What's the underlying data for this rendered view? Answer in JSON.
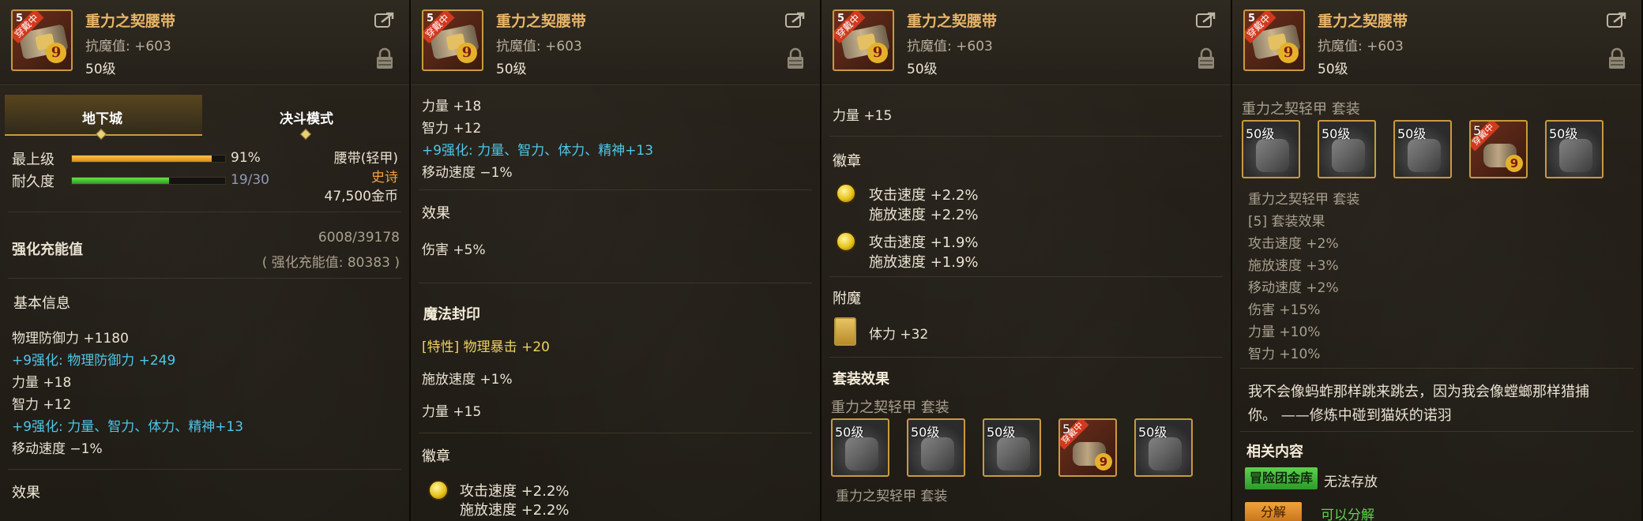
{
  "header": {
    "title": "重力之契腰带",
    "stat": "抗魔值: +603",
    "level": "50级",
    "icon_badge": "穿戴中",
    "icon_number": "9",
    "icon_corner": "5"
  },
  "panel1": {
    "tabs": [
      "地下城",
      "决斗模式"
    ],
    "active_tab": 0,
    "max_level_label": "最上级",
    "max_level_value": "91%",
    "max_level_fraction": 0.91,
    "durability_label": "耐久度",
    "durability_value": "19/30",
    "durability_fraction": 0.633,
    "slot_type": "腰带(轻甲)",
    "rarity": "史诗",
    "price": "47,500金币",
    "amplify_label": "强化充能值",
    "amplify_value": "6008/39178",
    "amplify_note": "( 强化充能值: 80383 )",
    "basic_info": "基本信息",
    "lines": [
      {
        "text": "物理防御力 +1180",
        "color": "white"
      },
      {
        "text": "+9强化: 物理防御力 +249",
        "color": "cyan"
      },
      {
        "text": "力量 +18",
        "color": "white"
      },
      {
        "text": "智力 +12",
        "color": "white"
      },
      {
        "text": "+9强化: 力量、智力、体力、精神+13",
        "color": "cyan"
      },
      {
        "text": "移动速度 −1%",
        "color": "white"
      }
    ],
    "effects_label": "效果"
  },
  "panel2": {
    "lines_top": [
      {
        "text": "力量 +18",
        "color": "white"
      },
      {
        "text": "智力 +12",
        "color": "white"
      },
      {
        "text": "+9强化: 力量、智力、体力、精神+13",
        "color": "cyan"
      },
      {
        "text": "移动速度 −1%",
        "color": "white"
      }
    ],
    "effects_label": "效果",
    "damage": "伤害 +5%",
    "magic_seal_label": "魔法封印",
    "trait": "[特性] 物理暴击 +20",
    "cast_speed": "施放速度 +1%",
    "strength": "力量 +15",
    "emblem_label": "徽章",
    "emblem_line1": "攻击速度 +2.2%",
    "emblem_line2": "施放速度 +2.2%"
  },
  "panel3": {
    "strength": "力量 +15",
    "emblem_label": "徽章",
    "emblems": [
      {
        "line1": "攻击速度 +2.2%",
        "line2": "施放速度 +2.2%"
      },
      {
        "line1": "攻击速度 +1.9%",
        "line2": "施放速度 +1.9%"
      }
    ],
    "enchant_label": "附魔",
    "enchant_value": "体力 +32",
    "set_effect_label": "套装效果",
    "set_name": "重力之契轻甲 套装",
    "slot_levels": [
      "50级",
      "50级",
      "50级",
      "5",
      "50级"
    ],
    "set_footer": "重力之契轻甲 套装"
  },
  "panel4": {
    "set_name": "重力之契轻甲 套装",
    "slot_levels": [
      "50级",
      "50级",
      "50级",
      "5",
      "50级"
    ],
    "set_name2": "重力之契轻甲 套装",
    "set_bonus_title": "[5] 套装效果",
    "bonuses": [
      "攻击速度 +2%",
      "施放速度 +3%",
      "移动速度 +2%",
      "伤害 +15%",
      "力量 +10%",
      "智力 +10%"
    ],
    "quote_line1": "我不会像蚂蚱那样跳来跳去，因为我会像螳螂那样猎捕",
    "quote_line2": "你。 ——修炼中碰到猫妖的诺羽",
    "related_label": "相关内容",
    "adventure_button": "冒险团金库",
    "cannot_store": "无法存放",
    "bottom_button": "分解",
    "bottom_note": "可以分解"
  },
  "colors": {
    "title": "#e8b56a",
    "cyan": "#4fc6e8",
    "rarity": "#f0a040",
    "bar_orange": "#f0a520",
    "bar_green": "#3fbf2c"
  }
}
